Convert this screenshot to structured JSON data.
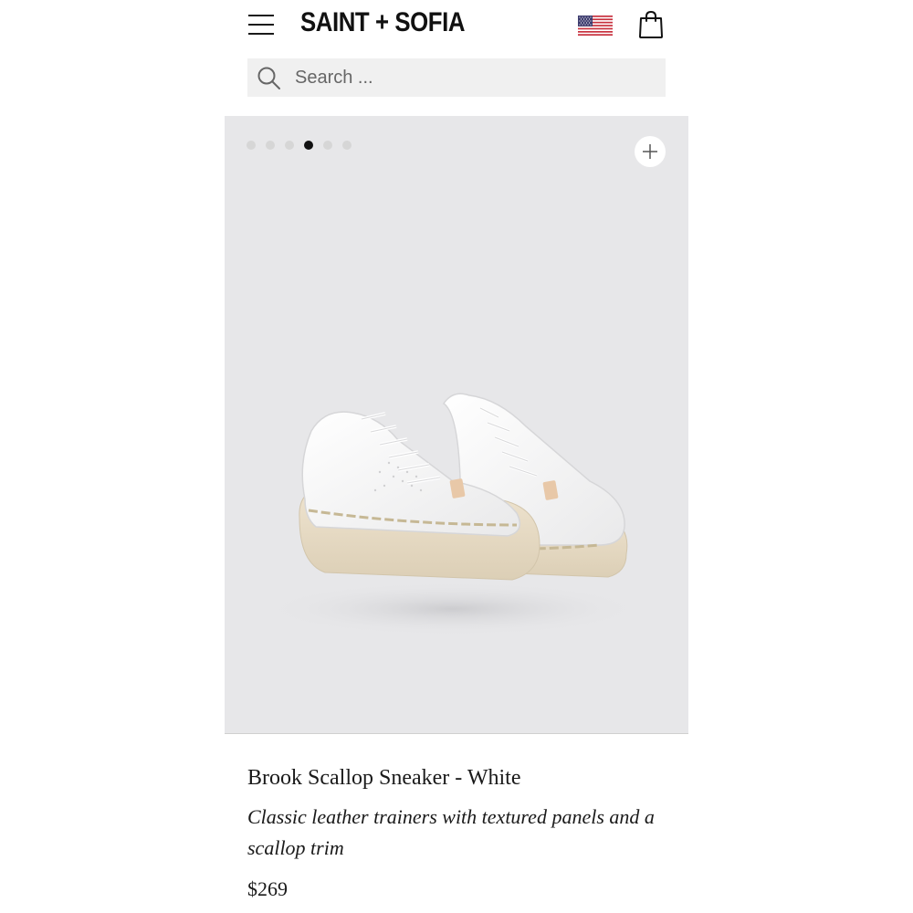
{
  "header": {
    "menu_icon": "hamburger-menu-icon",
    "logo": "SAINT + SOFIA",
    "flag_icon": "us-flag-icon",
    "cart_icon": "shopping-bag-icon"
  },
  "search": {
    "icon": "search-icon",
    "placeholder": "Search ...",
    "value": ""
  },
  "gallery": {
    "slide_count": 6,
    "active_slide": 4,
    "zoom_icon": "plus-icon",
    "image": "white-sneaker-product-image"
  },
  "product": {
    "title": "Brook Scallop Sneaker - White",
    "description": "Classic leather trainers with textured panels and a scallop trim",
    "price": "$269"
  },
  "colors": {
    "gallery_bg": "#e7e7e9",
    "search_bg": "#f0f0f0",
    "active_dot": "#111111",
    "inactive_dot": "#d6d6d6"
  }
}
